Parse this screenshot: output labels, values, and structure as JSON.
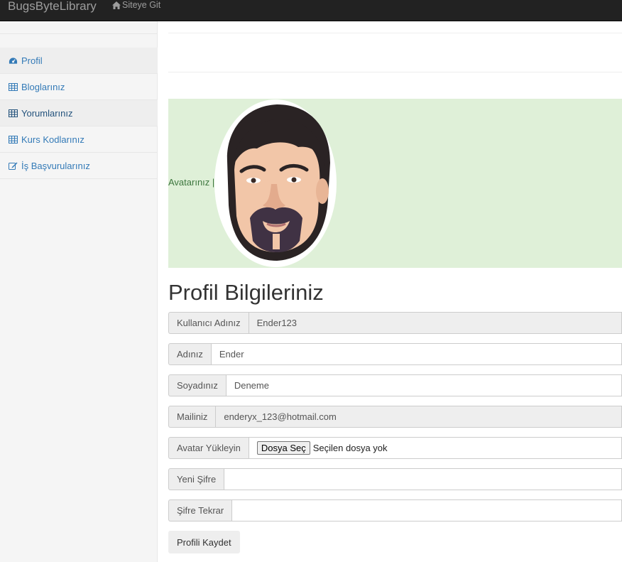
{
  "navbar": {
    "brand": "BugsByteLibrary",
    "site_link": "Siteye Git"
  },
  "sidebar": {
    "items": [
      {
        "label": "Profil",
        "icon": "dashboard-icon"
      },
      {
        "label": "Bloglarınız",
        "icon": "table-icon"
      },
      {
        "label": "Yorumlarınız",
        "icon": "table-icon"
      },
      {
        "label": "Kurs Kodlarınız",
        "icon": "table-icon"
      },
      {
        "label": "İş Başvurularınız",
        "icon": "edit-icon"
      }
    ]
  },
  "avatar": {
    "label": "Avatarınız |"
  },
  "main": {
    "title": "Profil Bilgileriniz"
  },
  "form": {
    "username_label": "Kullanıcı Adınız",
    "username_value": "Ender123",
    "firstname_label": "Adınız",
    "firstname_value": "Ender",
    "lastname_label": "Soyadınız",
    "lastname_value": "Deneme",
    "mail_label": "Mailiniz",
    "mail_value": "enderyx_123@hotmail.com",
    "avatar_upload_label": "Avatar Yükleyin",
    "file_button": "Dosya Seç",
    "file_status": "Seçilen dosya yok",
    "new_password_label": "Yeni Şifre",
    "repeat_password_label": "Şifre Tekrar",
    "save_button": "Profili Kaydet"
  },
  "colors": {
    "navbar_bg": "#222222",
    "link": "#337ab7",
    "success_bg": "#dff0d8",
    "success_text": "#3c763d"
  }
}
